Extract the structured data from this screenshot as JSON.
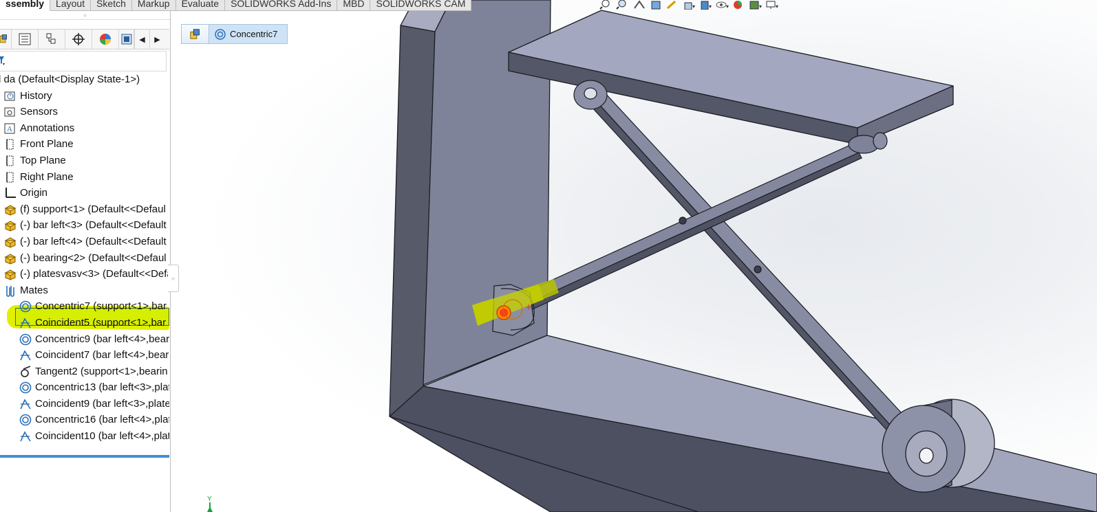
{
  "ribbon": {
    "tabs": [
      {
        "label": "ssembly",
        "active": true
      },
      {
        "label": "Layout"
      },
      {
        "label": "Sketch"
      },
      {
        "label": "Markup"
      },
      {
        "label": "Evaluate"
      },
      {
        "label": "SOLIDWORKS Add-Ins"
      },
      {
        "label": "MBD"
      },
      {
        "label": "SOLIDWORKS CAM"
      }
    ]
  },
  "panel": {
    "tabs": [
      "featuremanager",
      "propertymanager",
      "configurationmanager",
      "dimxpertmanager",
      "displaymanager",
      "cam-feature-tree"
    ],
    "tree": {
      "root": "l da  (Default<Display State-1>)",
      "items": [
        {
          "label": "History",
          "icon": "history-icon",
          "level": 0
        },
        {
          "label": "Sensors",
          "icon": "sensors-icon",
          "level": 0
        },
        {
          "label": "Annotations",
          "icon": "annotations-icon",
          "level": 0
        },
        {
          "label": "Front Plane",
          "icon": "plane-icon",
          "level": 0
        },
        {
          "label": "Top Plane",
          "icon": "plane-icon",
          "level": 0
        },
        {
          "label": "Right Plane",
          "icon": "plane-icon",
          "level": 0
        },
        {
          "label": "Origin",
          "icon": "origin-icon",
          "level": 0
        },
        {
          "label": "(f) support<1> (Default<<Defaul",
          "icon": "part-icon",
          "level": 0
        },
        {
          "label": "(-) bar left<3> (Default<<Default",
          "icon": "part-icon",
          "level": 0
        },
        {
          "label": "(-) bar left<4> (Default<<Default",
          "icon": "part-icon",
          "level": 0
        },
        {
          "label": "(-) bearing<2> (Default<<Defaul",
          "icon": "part-icon",
          "level": 0
        },
        {
          "label": "(-) platesvasv<3> (Default<<Defa",
          "icon": "part-icon",
          "level": 0
        },
        {
          "label": "Mates",
          "icon": "mates-icon",
          "level": 0
        },
        {
          "label": "Concentric7 (support<1>,bar",
          "icon": "concentric-icon",
          "level": 1,
          "selected": true
        },
        {
          "label": "Coincident5 (support<1>,bar",
          "icon": "coincident-icon",
          "level": 1
        },
        {
          "label": "Concentric9 (bar left<4>,bear",
          "icon": "concentric-icon",
          "level": 1
        },
        {
          "label": "Coincident7 (bar left<4>,bear",
          "icon": "coincident-icon",
          "level": 1
        },
        {
          "label": "Tangent2 (support<1>,bearin",
          "icon": "tangent-icon",
          "level": 1
        },
        {
          "label": "Concentric13 (bar left<3>,plat",
          "icon": "concentric-icon",
          "level": 1
        },
        {
          "label": "Coincident9 (bar left<3>,plate",
          "icon": "coincident-icon",
          "level": 1
        },
        {
          "label": "Concentric16 (bar left<4>,plat",
          "icon": "concentric-icon",
          "level": 1
        },
        {
          "label": "Coincident10 (bar left<4>,plat",
          "icon": "coincident-icon",
          "level": 1
        }
      ]
    }
  },
  "viewport": {
    "breadcrumb": {
      "mate_label": "Concentric7"
    },
    "triad_label": "Y",
    "colors": {
      "selection_highlight": "#d6ee00",
      "part_face_top": "#a3a7bf",
      "part_face_side": "#4e5262",
      "part_face_front": "#7c8097"
    }
  }
}
